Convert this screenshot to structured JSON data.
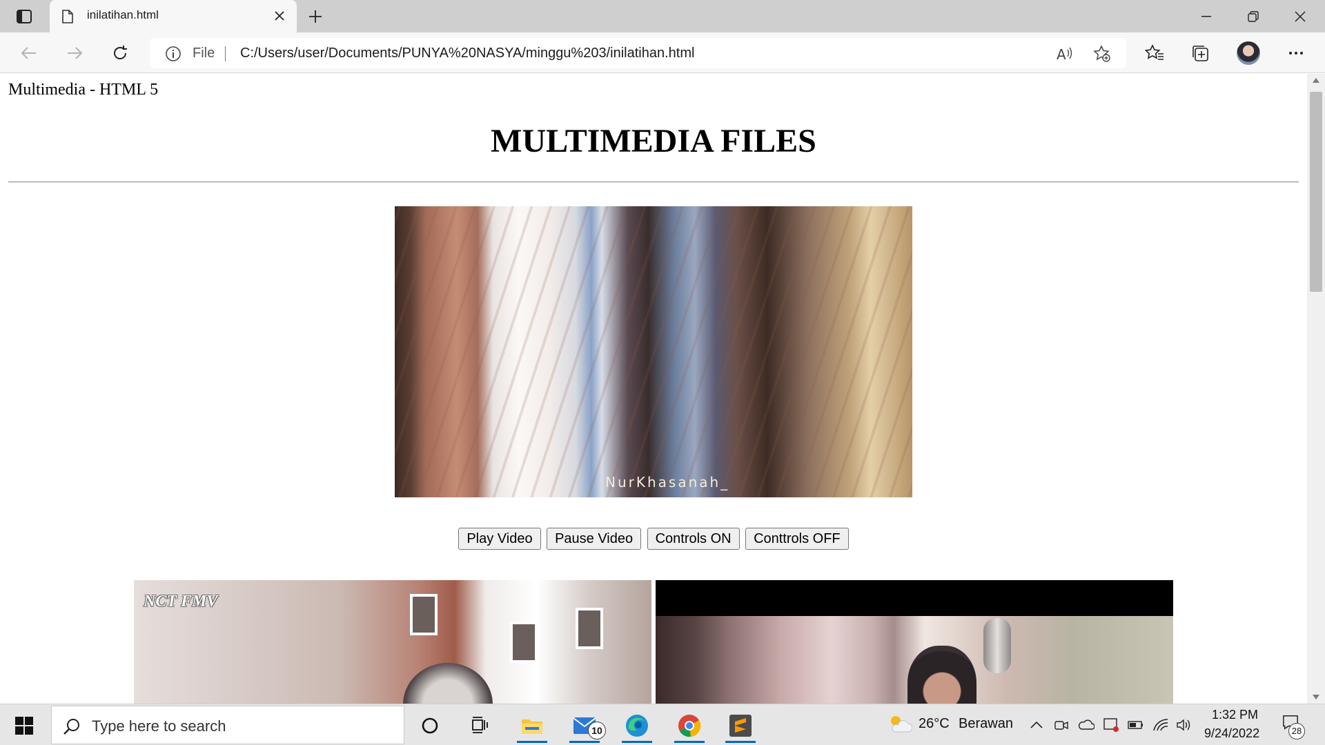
{
  "browser": {
    "tab_title": "inilatihan.html",
    "address_scheme_label": "File",
    "url": "C:/Users/user/Documents/PUNYA%20NASYA/minggu%203/inilatihan.html"
  },
  "page": {
    "document_title": "Multimedia - HTML 5",
    "heading": "MULTIMEDIA FILES",
    "video_watermark": "NurKhasanah_",
    "buttons": {
      "play": "Play Video",
      "pause": "Pause Video",
      "controls_on": "Controls ON",
      "controls_off": "Conttrols OFF"
    },
    "thumbnail_1_label": "NCT FMV"
  },
  "taskbar": {
    "search_placeholder": "Type here to search",
    "mail_badge": "10",
    "weather_temp": "26°C",
    "weather_desc": "Berawan",
    "time": "1:32 PM",
    "date": "9/24/2022",
    "notification_count": "28"
  },
  "colors": {
    "tabbar_bg": "#cfcfcf",
    "toolbar_bg": "#f7f7f7",
    "taskbar_bg": "#e6e6e6",
    "accent": "#0067c0"
  },
  "icons": [
    "tab-actions-icon",
    "document-icon",
    "close-icon",
    "plus-icon",
    "minimize-icon",
    "restore-icon",
    "window-close-icon",
    "back-arrow-icon",
    "forward-arrow-icon",
    "refresh-icon",
    "info-icon",
    "read-aloud-icon",
    "add-favorite-icon",
    "favorites-icon",
    "collections-icon",
    "more-icon",
    "windows-logo-icon",
    "search-icon",
    "cortana-icon",
    "task-view-icon",
    "file-explorer-icon",
    "mail-icon",
    "edge-icon",
    "chrome-icon",
    "sublime-text-icon",
    "weather-icon",
    "chevron-up-icon",
    "meet-now-icon",
    "onedrive-icon",
    "security-icon",
    "battery-icon",
    "wifi-icon",
    "volume-icon",
    "notifications-icon"
  ]
}
